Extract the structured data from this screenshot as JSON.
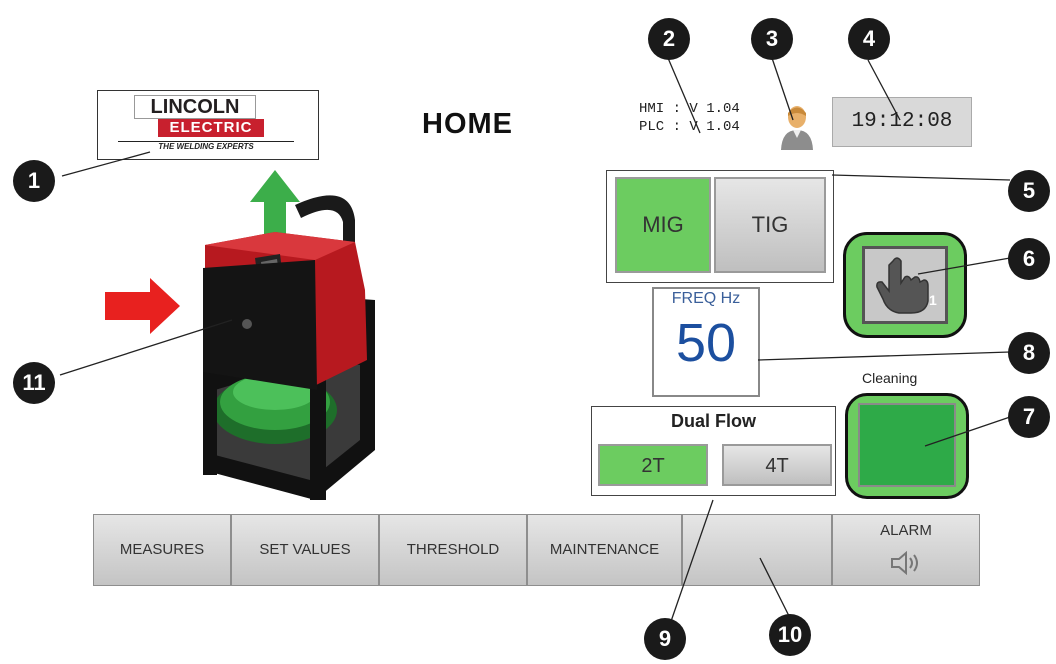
{
  "header": {
    "logo_line1": "LINCOLN",
    "logo_line2": "ELECTRIC",
    "logo_tagline": "THE WELDING EXPERTS",
    "title": "HOME",
    "hmi_version": "HMI : V 1.04",
    "plc_version": "PLC : V 1.04",
    "clock": "19:12:08"
  },
  "mode": {
    "mig_label": "MIG",
    "tig_label": "TIG",
    "selected": "MIG"
  },
  "freq": {
    "label": "FREQ Hz",
    "value": "50"
  },
  "cleaning": {
    "label": "Cleaning"
  },
  "dual_flow": {
    "label": "Dual Flow",
    "t2_label": "2T",
    "t4_label": "4T",
    "selected": "2T"
  },
  "nav": {
    "measures": "MEASURES",
    "set_values": "SET VALUES",
    "threshold": "THRESHOLD",
    "maintenance": "MAINTENANCE",
    "empty": "",
    "alarm": "ALARM"
  },
  "callouts": [
    "1",
    "2",
    "3",
    "4",
    "5",
    "6",
    "7",
    "8",
    "9",
    "10",
    "11"
  ],
  "colors": {
    "active_green": "#6ccc60",
    "cleaning_green": "#2eaa48",
    "brand_red": "#c8202e",
    "freq_blue": "#1c4f9f"
  },
  "icons": [
    "user-icon",
    "hand-pointer-icon",
    "speaker-icon",
    "machine-illustration",
    "red-arrow-icon",
    "green-arrow-icon"
  ]
}
